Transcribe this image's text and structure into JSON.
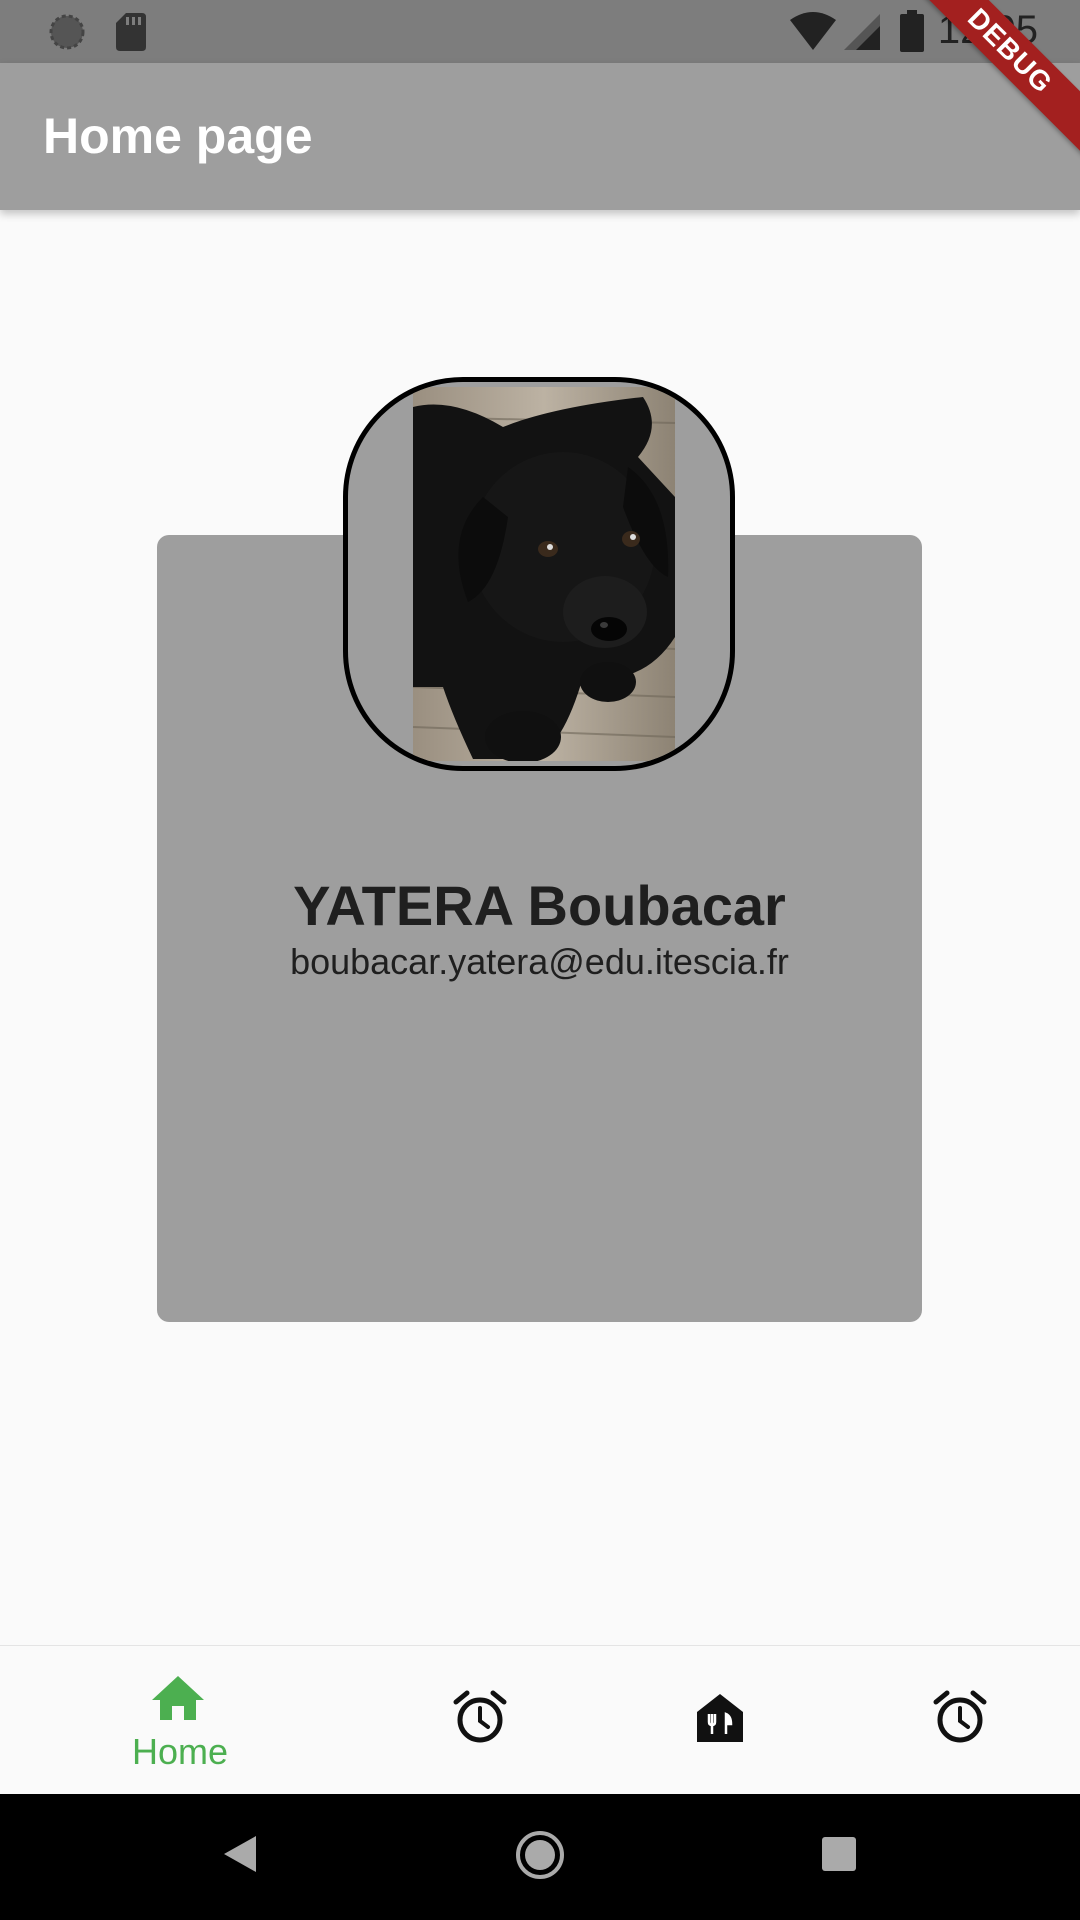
{
  "status_bar": {
    "time": "12:05",
    "icons": [
      "loading-circle-icon",
      "sd-card-icon",
      "wifi-icon",
      "signal-icon",
      "battery-icon"
    ]
  },
  "debug_banner": {
    "label": "DEBUG"
  },
  "app_bar": {
    "title": "Home page"
  },
  "profile": {
    "avatar": "black-puppy-photo",
    "name": "YATERA Boubacar",
    "email": "boubacar.yatera@edu.itescia.fr"
  },
  "bottom_nav": {
    "active_color": "#4caf50",
    "items": [
      {
        "icon": "home-icon",
        "label": "Home",
        "active": true
      },
      {
        "icon": "alarm-icon",
        "label": "",
        "active": false
      },
      {
        "icon": "restaurant-icon",
        "label": "",
        "active": false
      },
      {
        "icon": "alarm-icon",
        "label": "",
        "active": false
      }
    ]
  },
  "system_nav": {
    "buttons": [
      "back-icon",
      "home-circle-icon",
      "recents-icon"
    ]
  }
}
